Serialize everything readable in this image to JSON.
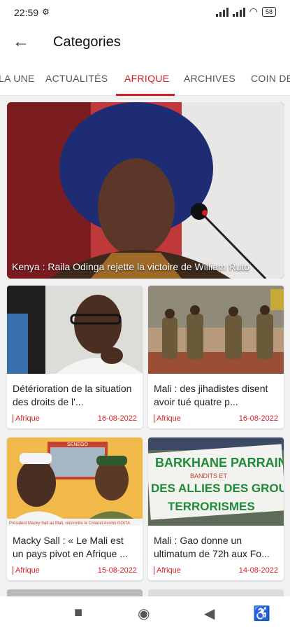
{
  "status": {
    "time": "22:59",
    "battery": "58"
  },
  "appbar": {
    "title": "Categories"
  },
  "tabs": [
    {
      "label": "A LA UNE"
    },
    {
      "label": "ACTUALITÉS"
    },
    {
      "label": "AFRIQUE"
    },
    {
      "label": "ARCHIVES"
    },
    {
      "label": "COIN DE"
    }
  ],
  "hero": {
    "title": "Kenya : Raila Odinga rejette la victoire de William Ruto"
  },
  "cards": [
    {
      "title": "Détérioration de la situation des droits de l'...",
      "category": "Afrique",
      "date": "16-08-2022"
    },
    {
      "title": "Mali : des jihadistes disent avoir tué quatre p...",
      "category": "Afrique",
      "date": "16-08-2022"
    },
    {
      "title": "Macky Sall : « Le Mali est un pays pivot en Afrique ...",
      "category": "Afrique",
      "date": "15-08-2022"
    },
    {
      "title": "Mali : Gao donne un ultimatum de 72h aux Fo...",
      "category": "Afrique",
      "date": "14-08-2022"
    }
  ],
  "images": {
    "card3_caption": "Président Macky Sall au Mali, rencontre le Colonel Assimi GOITA",
    "card3_banner": "SENEGO",
    "card4_banner_1": "BARKHANE PARRAIN",
    "card4_banner_2": "DES ALLIES DES GROUPES",
    "card4_banner_3": "TERRORISMES",
    "card4_small": "BANDITS ET"
  }
}
